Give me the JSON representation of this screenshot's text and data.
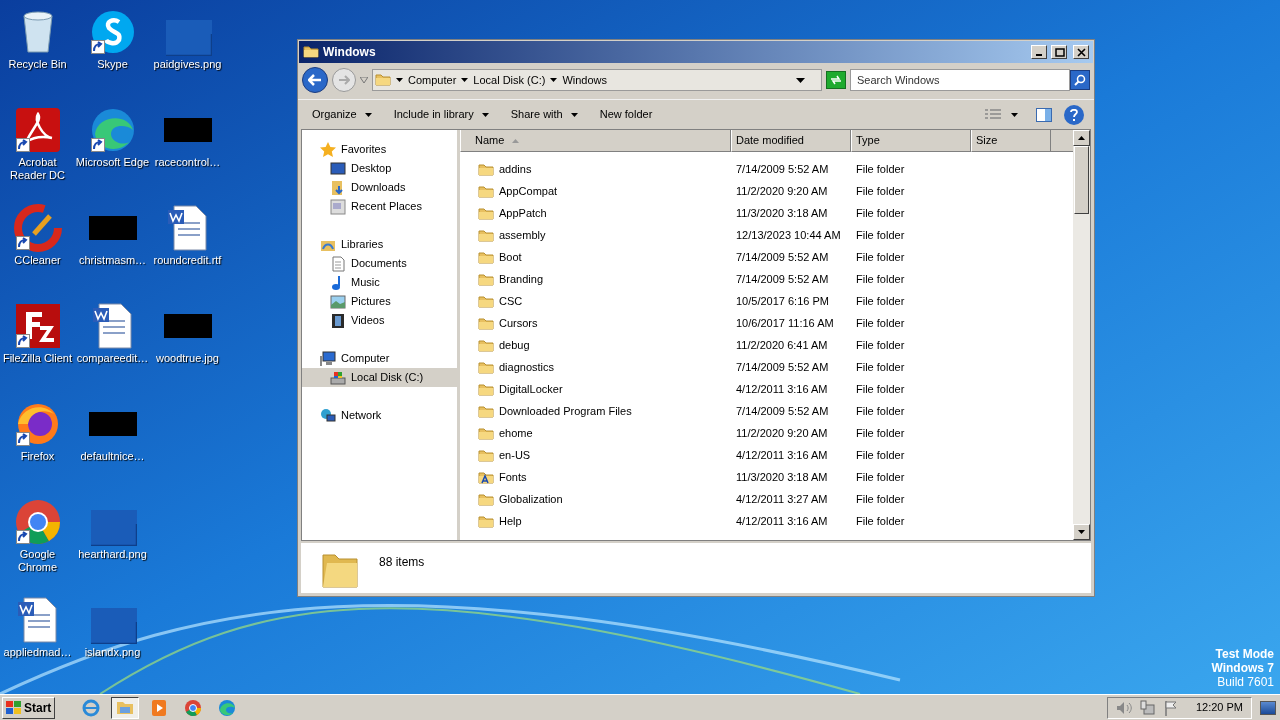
{
  "desktop_icons": [
    {
      "label": "Recycle Bin",
      "kind": "recycle",
      "shortcut": false
    },
    {
      "label": "Acrobat Reader DC",
      "kind": "acrobat",
      "shortcut": true
    },
    {
      "label": "CCleaner",
      "kind": "ccleaner",
      "shortcut": true
    },
    {
      "label": "FileZilla Client",
      "kind": "filezilla",
      "shortcut": true
    },
    {
      "label": "Firefox",
      "kind": "firefox",
      "shortcut": true
    },
    {
      "label": "Google Chrome",
      "kind": "chrome",
      "shortcut": true
    },
    {
      "label": "appliedmad…",
      "kind": "word",
      "shortcut": false
    },
    {
      "label": "Skype",
      "kind": "skype",
      "shortcut": true
    },
    {
      "label": "Microsoft Edge",
      "kind": "edge",
      "shortcut": true
    },
    {
      "label": "christmasm…",
      "kind": "dark",
      "shortcut": false
    },
    {
      "label": "compareedit…",
      "kind": "word",
      "shortcut": false
    },
    {
      "label": "defaultnice…",
      "kind": "dark",
      "shortcut": false
    },
    {
      "label": "hearthard.png",
      "kind": "blank",
      "shortcut": false
    },
    {
      "label": "islandx.png",
      "kind": "blank",
      "shortcut": false
    },
    {
      "label": "paidgives.png",
      "kind": "blank",
      "shortcut": false
    },
    {
      "label": "racecontrol…",
      "kind": "dark",
      "shortcut": false
    },
    {
      "label": "roundcredit.rtf",
      "kind": "word",
      "shortcut": false
    },
    {
      "label": "woodtrue.jpg",
      "kind": "dark",
      "shortcut": false
    }
  ],
  "window": {
    "title": "Windows",
    "breadcrumb": [
      "Computer",
      "Local Disk (C:)",
      "Windows"
    ],
    "search": {
      "placeholder": "Search Windows"
    },
    "toolbar": [
      {
        "label": "Organize",
        "menu": true
      },
      {
        "label": "Include in library",
        "menu": true
      },
      {
        "label": "Share with",
        "menu": true
      },
      {
        "label": "New folder",
        "menu": false
      }
    ],
    "nav": [
      {
        "label": "Favorites",
        "kind": "star",
        "selected": false,
        "children": [
          {
            "label": "Desktop",
            "kind": "desktop",
            "selected": false
          },
          {
            "label": "Downloads",
            "kind": "downloads",
            "selected": false
          },
          {
            "label": "Recent Places",
            "kind": "recent",
            "selected": false
          }
        ]
      },
      {
        "label": "Libraries",
        "kind": "libraries",
        "selected": false,
        "children": [
          {
            "label": "Documents",
            "kind": "documents",
            "selected": false
          },
          {
            "label": "Music",
            "kind": "music",
            "selected": false
          },
          {
            "label": "Pictures",
            "kind": "pictures",
            "selected": false
          },
          {
            "label": "Videos",
            "kind": "videos",
            "selected": false
          }
        ]
      },
      {
        "label": "Computer",
        "kind": "computer",
        "selected": false,
        "children": [
          {
            "label": "Local Disk (C:)",
            "kind": "disk",
            "selected": true
          }
        ]
      },
      {
        "label": "Network",
        "kind": "network",
        "selected": false
      }
    ],
    "columns": [
      {
        "label": "Name",
        "sorted": true
      },
      {
        "label": "Date modified",
        "sorted": false
      },
      {
        "label": "Type",
        "sorted": false
      },
      {
        "label": "Size",
        "sorted": false
      }
    ],
    "files": [
      {
        "name": "addins",
        "date": "7/14/2009 5:52 AM",
        "type": "File folder",
        "kind": "folder"
      },
      {
        "name": "AppCompat",
        "date": "11/2/2020 9:20 AM",
        "type": "File folder",
        "kind": "folder"
      },
      {
        "name": "AppPatch",
        "date": "11/3/2020 3:18 AM",
        "type": "File folder",
        "kind": "folder"
      },
      {
        "name": "assembly",
        "date": "12/13/2023 10:44 AM",
        "type": "File folder",
        "kind": "folder"
      },
      {
        "name": "Boot",
        "date": "7/14/2009 5:52 AM",
        "type": "File folder",
        "kind": "folder"
      },
      {
        "name": "Branding",
        "date": "7/14/2009 5:52 AM",
        "type": "File folder",
        "kind": "folder"
      },
      {
        "name": "CSC",
        "date": "10/5/2017 6:16 PM",
        "type": "File folder",
        "kind": "folder"
      },
      {
        "name": "Cursors",
        "date": "10/6/2017 11:16 AM",
        "type": "File folder",
        "kind": "folder"
      },
      {
        "name": "debug",
        "date": "11/2/2020 6:41 AM",
        "type": "File folder",
        "kind": "folder"
      },
      {
        "name": "diagnostics",
        "date": "7/14/2009 5:52 AM",
        "type": "File folder",
        "kind": "folder"
      },
      {
        "name": "DigitalLocker",
        "date": "4/12/2011 3:16 AM",
        "type": "File folder",
        "kind": "folder"
      },
      {
        "name": "Downloaded Program Files",
        "date": "7/14/2009 5:52 AM",
        "type": "File folder",
        "kind": "folder"
      },
      {
        "name": "ehome",
        "date": "11/2/2020 9:20 AM",
        "type": "File folder",
        "kind": "folder"
      },
      {
        "name": "en-US",
        "date": "4/12/2011 3:16 AM",
        "type": "File folder",
        "kind": "folder"
      },
      {
        "name": "Fonts",
        "date": "11/3/2020 3:18 AM",
        "type": "File folder",
        "kind": "fonts"
      },
      {
        "name": "Globalization",
        "date": "4/12/2011 3:27 AM",
        "type": "File folder",
        "kind": "folder"
      },
      {
        "name": "Help",
        "date": "4/12/2011 3:16 AM",
        "type": "File folder",
        "kind": "folder"
      }
    ],
    "details": {
      "count": "88 items"
    }
  },
  "desktop_notice": [
    "Test Mode",
    "Windows 7",
    "Build 7601"
  ],
  "taskbar": {
    "start": "Start",
    "apps": [
      {
        "kind": "ie",
        "selected": false
      },
      {
        "kind": "explorer",
        "selected": true
      },
      {
        "kind": "media",
        "selected": false
      },
      {
        "kind": "chrome",
        "selected": false
      },
      {
        "kind": "edge",
        "selected": false
      }
    ],
    "clock": "12:20 PM"
  }
}
